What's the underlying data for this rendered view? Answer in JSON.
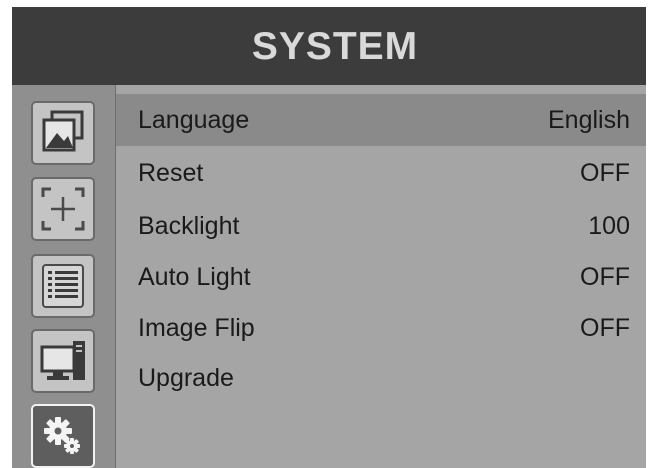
{
  "header": {
    "title": "SYSTEM"
  },
  "sidebar": {
    "items": [
      {
        "icon": "picture-icon",
        "active": false
      },
      {
        "icon": "marker-crosshair-icon",
        "active": false
      },
      {
        "icon": "list-icon",
        "active": false
      },
      {
        "icon": "display-computer-icon",
        "active": false
      },
      {
        "icon": "gears-icon",
        "active": true
      }
    ]
  },
  "menu": {
    "items": [
      {
        "label": "Language",
        "value": "English",
        "selected": true
      },
      {
        "label": "Reset",
        "value": "OFF",
        "selected": false
      },
      {
        "label": "Backlight",
        "value": "100",
        "selected": false
      },
      {
        "label": "Auto Light",
        "value": "OFF",
        "selected": false
      },
      {
        "label": "Image Flip",
        "value": "OFF",
        "selected": false
      },
      {
        "label": "Upgrade",
        "value": "",
        "selected": false
      }
    ]
  },
  "colors": {
    "titlebar": "#3c3c3c",
    "title_text": "#d9d9d9",
    "panel": "#a5a5a5",
    "sidebar": "#8f8f8f",
    "selected_row": "#8a8a8a",
    "text": "#1a1a1a"
  }
}
